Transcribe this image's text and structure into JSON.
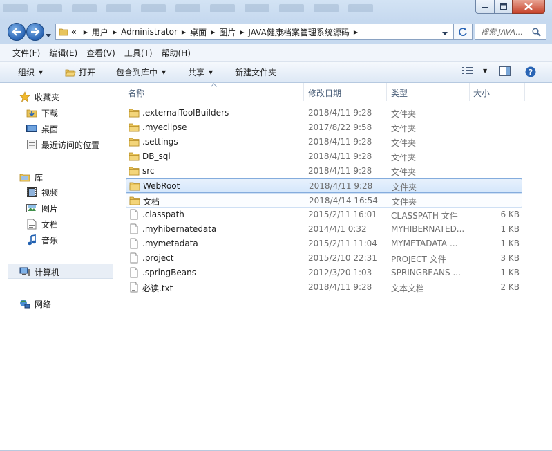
{
  "window": {
    "minimize_icon": "minimize-icon",
    "maximize_icon": "maximize-icon",
    "close_icon": "close-icon"
  },
  "address": {
    "overflow": "«",
    "crumbs": [
      "用户",
      "Administrator",
      "桌面",
      "图片",
      "JAVA健康档案管理系统源码"
    ],
    "search_placeholder": "搜索 JAVA..."
  },
  "menu": [
    "文件(F)",
    "编辑(E)",
    "查看(V)",
    "工具(T)",
    "帮助(H)"
  ],
  "toolbar": {
    "organize": "组织",
    "open": "打开",
    "include_library": "包含到库中",
    "share": "共享",
    "new_folder": "新建文件夹"
  },
  "nav": {
    "favorites": "收藏夹",
    "downloads": "下载",
    "desktop": "桌面",
    "recent": "最近访问的位置",
    "libraries": "库",
    "videos": "视频",
    "pictures": "图片",
    "documents": "文档",
    "music": "音乐",
    "computer": "计算机",
    "network": "网络"
  },
  "columns": {
    "name": "名称",
    "date": "修改日期",
    "type": "类型",
    "size": "大小"
  },
  "files": [
    {
      "name": ".externalToolBuilders",
      "date": "2018/4/11 9:28",
      "type": "文件夹",
      "size": "",
      "kind": "folder"
    },
    {
      "name": ".myeclipse",
      "date": "2017/8/22 9:58",
      "type": "文件夹",
      "size": "",
      "kind": "folder"
    },
    {
      "name": ".settings",
      "date": "2018/4/11 9:28",
      "type": "文件夹",
      "size": "",
      "kind": "folder"
    },
    {
      "name": "DB_sql",
      "date": "2018/4/11 9:28",
      "type": "文件夹",
      "size": "",
      "kind": "folder"
    },
    {
      "name": "src",
      "date": "2018/4/11 9:28",
      "type": "文件夹",
      "size": "",
      "kind": "folder"
    },
    {
      "name": "WebRoot",
      "date": "2018/4/11 9:28",
      "type": "文件夹",
      "size": "",
      "kind": "folder"
    },
    {
      "name": "文档",
      "date": "2018/4/14 16:54",
      "type": "文件夹",
      "size": "",
      "kind": "folder"
    },
    {
      "name": ".classpath",
      "date": "2015/2/11 16:01",
      "type": "CLASSPATH 文件",
      "size": "6 KB",
      "kind": "file"
    },
    {
      "name": ".myhibernatedata",
      "date": "2014/4/1 0:32",
      "type": "MYHIBERNATED...",
      "size": "1 KB",
      "kind": "file"
    },
    {
      "name": ".mymetadata",
      "date": "2015/2/11 11:04",
      "type": "MYMETADATA ...",
      "size": "1 KB",
      "kind": "file"
    },
    {
      "name": ".project",
      "date": "2015/2/10 22:31",
      "type": "PROJECT 文件",
      "size": "3 KB",
      "kind": "file"
    },
    {
      "name": ".springBeans",
      "date": "2012/3/20 1:03",
      "type": "SPRINGBEANS ...",
      "size": "1 KB",
      "kind": "file"
    },
    {
      "name": "必读.txt",
      "date": "2018/4/11 9:28",
      "type": "文本文档",
      "size": "2 KB",
      "kind": "text"
    }
  ],
  "selected_row": 5,
  "hover_row": 6,
  "colors": {
    "chrome": "#c6d9ef",
    "selection": "#d5e7fb",
    "selection_border": "#84acdd",
    "folder": "#e8c45c"
  }
}
